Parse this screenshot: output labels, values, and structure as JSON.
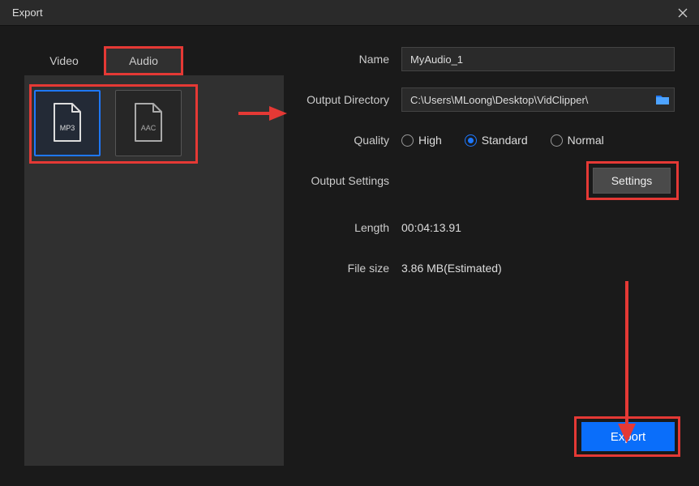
{
  "titlebar": {
    "title": "Export"
  },
  "tabs": {
    "video": "Video",
    "audio": "Audio"
  },
  "formats": {
    "mp3": "MP3",
    "aac": "AAC"
  },
  "form": {
    "name_label": "Name",
    "name_value": "MyAudio_1",
    "outdir_label": "Output Directory",
    "outdir_value": "C:\\Users\\MLoong\\Desktop\\VidClipper\\",
    "quality_label": "Quality",
    "quality_options": {
      "high": "High",
      "standard": "Standard",
      "normal": "Normal"
    },
    "output_settings_label": "Output Settings",
    "settings_btn": "Settings",
    "length_label": "Length",
    "length_value": "00:04:13.91",
    "filesize_label": "File size",
    "filesize_value": "3.86 MB(Estimated)"
  },
  "export_btn": "Export",
  "colors": {
    "highlight": "#e53935",
    "primary": "#0a6efa"
  }
}
